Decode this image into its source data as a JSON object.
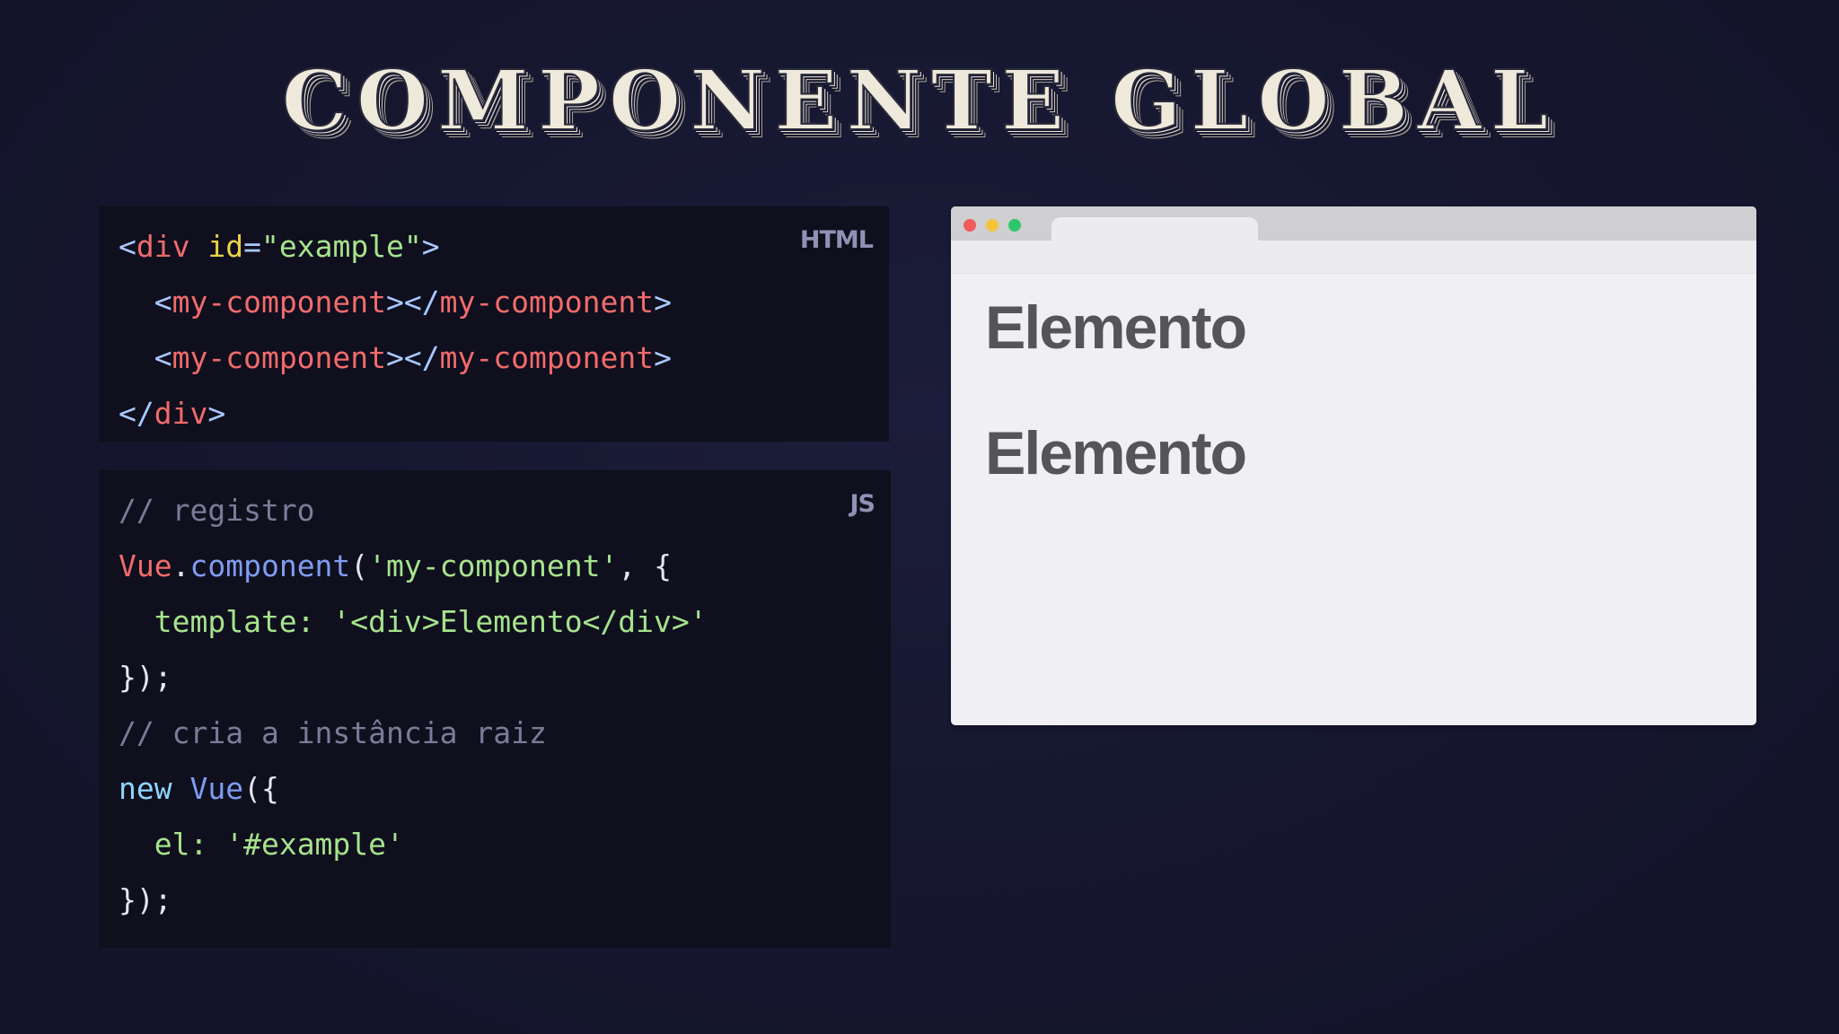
{
  "title": "COMPONENTE GLOBAL",
  "html_panel": {
    "label": "HTML",
    "lines": [
      {
        "tokens": [
          [
            "<",
            "punc"
          ],
          [
            "div",
            "tag"
          ],
          [
            " ",
            "plain"
          ],
          [
            "id",
            "attr"
          ],
          [
            "=",
            "punc"
          ],
          [
            "\"example\"",
            "str"
          ],
          [
            ">",
            "punc"
          ]
        ]
      },
      {
        "tokens": [
          [
            "  <",
            "punc"
          ],
          [
            "my-component",
            "tag"
          ],
          [
            "></",
            "punc"
          ],
          [
            "my-component",
            "tag"
          ],
          [
            ">",
            "punc"
          ]
        ]
      },
      {
        "tokens": [
          [
            "  <",
            "punc"
          ],
          [
            "my-component",
            "tag"
          ],
          [
            "></",
            "punc"
          ],
          [
            "my-component",
            "tag"
          ],
          [
            ">",
            "punc"
          ]
        ]
      },
      {
        "tokens": [
          [
            "</",
            "punc"
          ],
          [
            "div",
            "tag"
          ],
          [
            ">",
            "punc"
          ]
        ]
      }
    ]
  },
  "js_panel": {
    "label": "JS",
    "lines": [
      {
        "tokens": [
          [
            "// registro",
            "cmt"
          ]
        ]
      },
      {
        "tokens": [
          [
            "Vue",
            "obj"
          ],
          [
            ".",
            "plain"
          ],
          [
            "component",
            "fn"
          ],
          [
            "(",
            "plain"
          ],
          [
            "'my-component'",
            "str"
          ],
          [
            ", {",
            "plain"
          ]
        ]
      },
      {
        "tokens": [
          [
            "  template: ",
            "key"
          ],
          [
            "'<div>Elemento</div>'",
            "str"
          ]
        ]
      },
      {
        "tokens": [
          [
            "});",
            "plain"
          ]
        ]
      },
      {
        "tokens": [
          [
            "// cria a instância raiz",
            "cmt"
          ]
        ]
      },
      {
        "tokens": [
          [
            "new",
            "kw"
          ],
          [
            " ",
            "plain"
          ],
          [
            "Vue",
            "fn"
          ],
          [
            "({",
            "plain"
          ]
        ]
      },
      {
        "tokens": [
          [
            "  el: ",
            "key"
          ],
          [
            "'#example'",
            "str"
          ]
        ]
      },
      {
        "tokens": [
          [
            "});",
            "plain"
          ]
        ]
      }
    ]
  },
  "browser": {
    "elements": [
      "Elemento",
      "Elemento"
    ]
  },
  "colors": {
    "background": "#161730",
    "code_bg": "#0f0f1e",
    "browser_bg": "#f0eff3",
    "tag": "#f26b6b",
    "attr": "#ecd24a",
    "string": "#a6e38c",
    "comment": "#7a7d98",
    "function": "#7f9cf0"
  }
}
